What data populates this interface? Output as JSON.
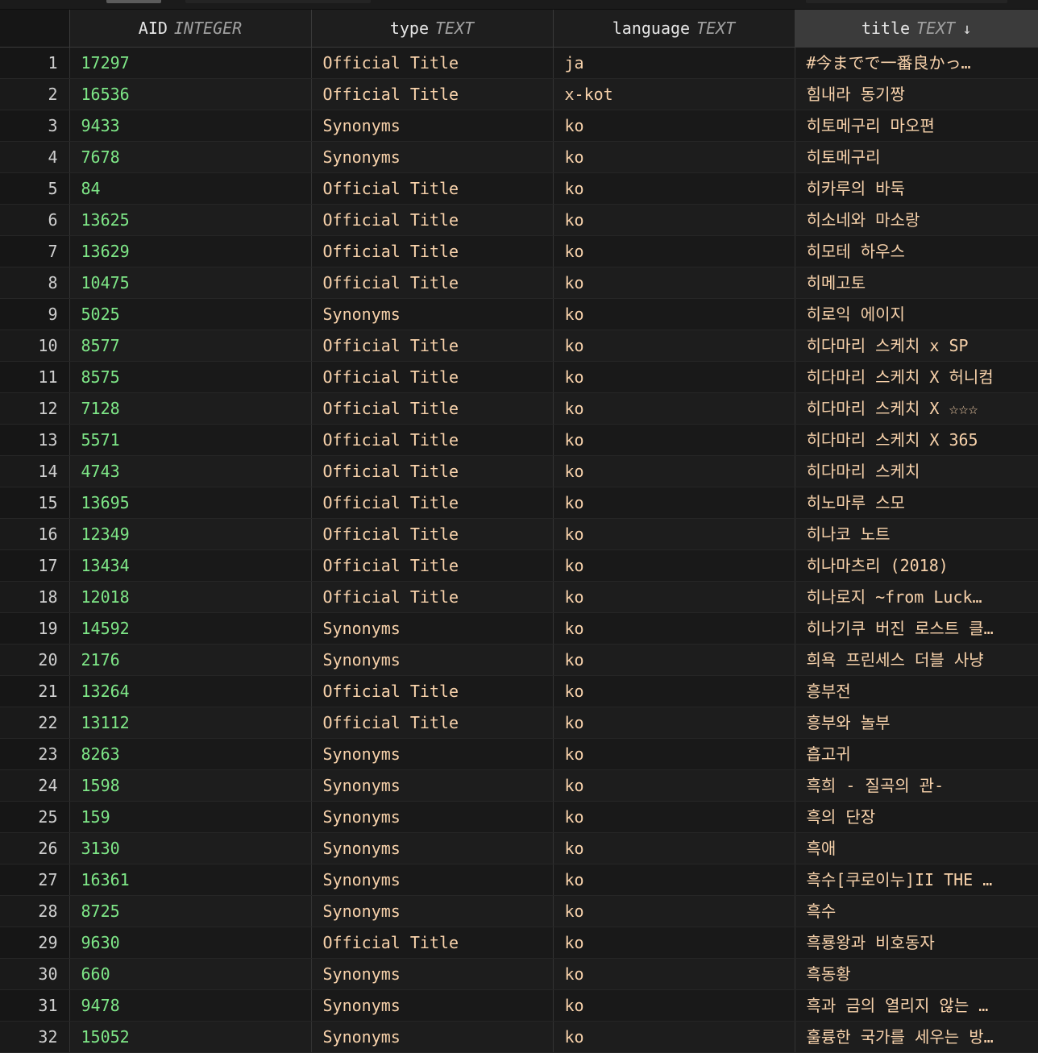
{
  "top_chrome": {
    "visible": true
  },
  "table": {
    "row_number_header": "",
    "columns": [
      {
        "name": "AID",
        "type": "INTEGER",
        "sorted": false,
        "sort_arrow": ""
      },
      {
        "name": "type",
        "type": "TEXT",
        "sorted": false,
        "sort_arrow": ""
      },
      {
        "name": "language",
        "type": "TEXT",
        "sorted": false,
        "sort_arrow": ""
      },
      {
        "name": "title",
        "type": "TEXT",
        "sorted": true,
        "sort_arrow": "↓"
      }
    ],
    "rows": [
      {
        "n": "1",
        "aid": "17297",
        "type": "Official Title",
        "language": "ja",
        "title": "#今までで一番良かっ…"
      },
      {
        "n": "2",
        "aid": "16536",
        "type": "Official Title",
        "language": "x-kot",
        "title": "힘내라 동기짱"
      },
      {
        "n": "3",
        "aid": "9433",
        "type": "Synonyms",
        "language": "ko",
        "title": "히토메구리 마오편"
      },
      {
        "n": "4",
        "aid": "7678",
        "type": "Synonyms",
        "language": "ko",
        "title": "히토메구리"
      },
      {
        "n": "5",
        "aid": "84",
        "type": "Official Title",
        "language": "ko",
        "title": "히카루의 바둑"
      },
      {
        "n": "6",
        "aid": "13625",
        "type": "Official Title",
        "language": "ko",
        "title": "히소네와 마소랑"
      },
      {
        "n": "7",
        "aid": "13629",
        "type": "Official Title",
        "language": "ko",
        "title": "히모테 하우스"
      },
      {
        "n": "8",
        "aid": "10475",
        "type": "Official Title",
        "language": "ko",
        "title": "히메고토"
      },
      {
        "n": "9",
        "aid": "5025",
        "type": "Synonyms",
        "language": "ko",
        "title": "히로익 에이지"
      },
      {
        "n": "10",
        "aid": "8577",
        "type": "Official Title",
        "language": "ko",
        "title": "히다마리 스케치 x SP"
      },
      {
        "n": "11",
        "aid": "8575",
        "type": "Official Title",
        "language": "ko",
        "title": "히다마리 스케치 X 허니컴"
      },
      {
        "n": "12",
        "aid": "7128",
        "type": "Official Title",
        "language": "ko",
        "title": "히다마리 스케치 X ☆☆☆"
      },
      {
        "n": "13",
        "aid": "5571",
        "type": "Official Title",
        "language": "ko",
        "title": "히다마리 스케치 X 365"
      },
      {
        "n": "14",
        "aid": "4743",
        "type": "Official Title",
        "language": "ko",
        "title": "히다마리 스케치"
      },
      {
        "n": "15",
        "aid": "13695",
        "type": "Official Title",
        "language": "ko",
        "title": "히노마루 스모"
      },
      {
        "n": "16",
        "aid": "12349",
        "type": "Official Title",
        "language": "ko",
        "title": "히나코 노트"
      },
      {
        "n": "17",
        "aid": "13434",
        "type": "Official Title",
        "language": "ko",
        "title": "히나마츠리 (2018)"
      },
      {
        "n": "18",
        "aid": "12018",
        "type": "Official Title",
        "language": "ko",
        "title": "히나로지 ~from Luck…"
      },
      {
        "n": "19",
        "aid": "14592",
        "type": "Synonyms",
        "language": "ko",
        "title": "히나기쿠 버진 로스트 클…"
      },
      {
        "n": "20",
        "aid": "2176",
        "type": "Synonyms",
        "language": "ko",
        "title": "희욕 프린세스 더블 사냥"
      },
      {
        "n": "21",
        "aid": "13264",
        "type": "Official Title",
        "language": "ko",
        "title": "흥부전"
      },
      {
        "n": "22",
        "aid": "13112",
        "type": "Official Title",
        "language": "ko",
        "title": "흥부와 놀부"
      },
      {
        "n": "23",
        "aid": "8263",
        "type": "Synonyms",
        "language": "ko",
        "title": "흡고귀"
      },
      {
        "n": "24",
        "aid": "1598",
        "type": "Synonyms",
        "language": "ko",
        "title": "흑희 - 질곡의 관-"
      },
      {
        "n": "25",
        "aid": "159",
        "type": "Synonyms",
        "language": "ko",
        "title": "흑의 단장"
      },
      {
        "n": "26",
        "aid": "3130",
        "type": "Synonyms",
        "language": "ko",
        "title": "흑애"
      },
      {
        "n": "27",
        "aid": "16361",
        "type": "Synonyms",
        "language": "ko",
        "title": "흑수[쿠로이누]II THE …"
      },
      {
        "n": "28",
        "aid": "8725",
        "type": "Synonyms",
        "language": "ko",
        "title": "흑수"
      },
      {
        "n": "29",
        "aid": "9630",
        "type": "Official Title",
        "language": "ko",
        "title": "흑룡왕과 비호동자"
      },
      {
        "n": "30",
        "aid": "660",
        "type": "Synonyms",
        "language": "ko",
        "title": "흑동황"
      },
      {
        "n": "31",
        "aid": "9478",
        "type": "Synonyms",
        "language": "ko",
        "title": "흑과 금의 열리지 않는 …"
      },
      {
        "n": "32",
        "aid": "15052",
        "type": "Synonyms",
        "language": "ko",
        "title": "훌륭한 국가를 세우는 방…"
      }
    ]
  },
  "colors": {
    "background": "#161616",
    "row_odd": "#191919",
    "row_even": "#1d1d1d",
    "header_bg": "#1e1e1e",
    "header_sorted_bg": "#3b3b3b",
    "integer_text": "#7ee787",
    "text_text": "#f8d2ab",
    "rownum_text": "#cfcfcf",
    "border": "#333333"
  }
}
